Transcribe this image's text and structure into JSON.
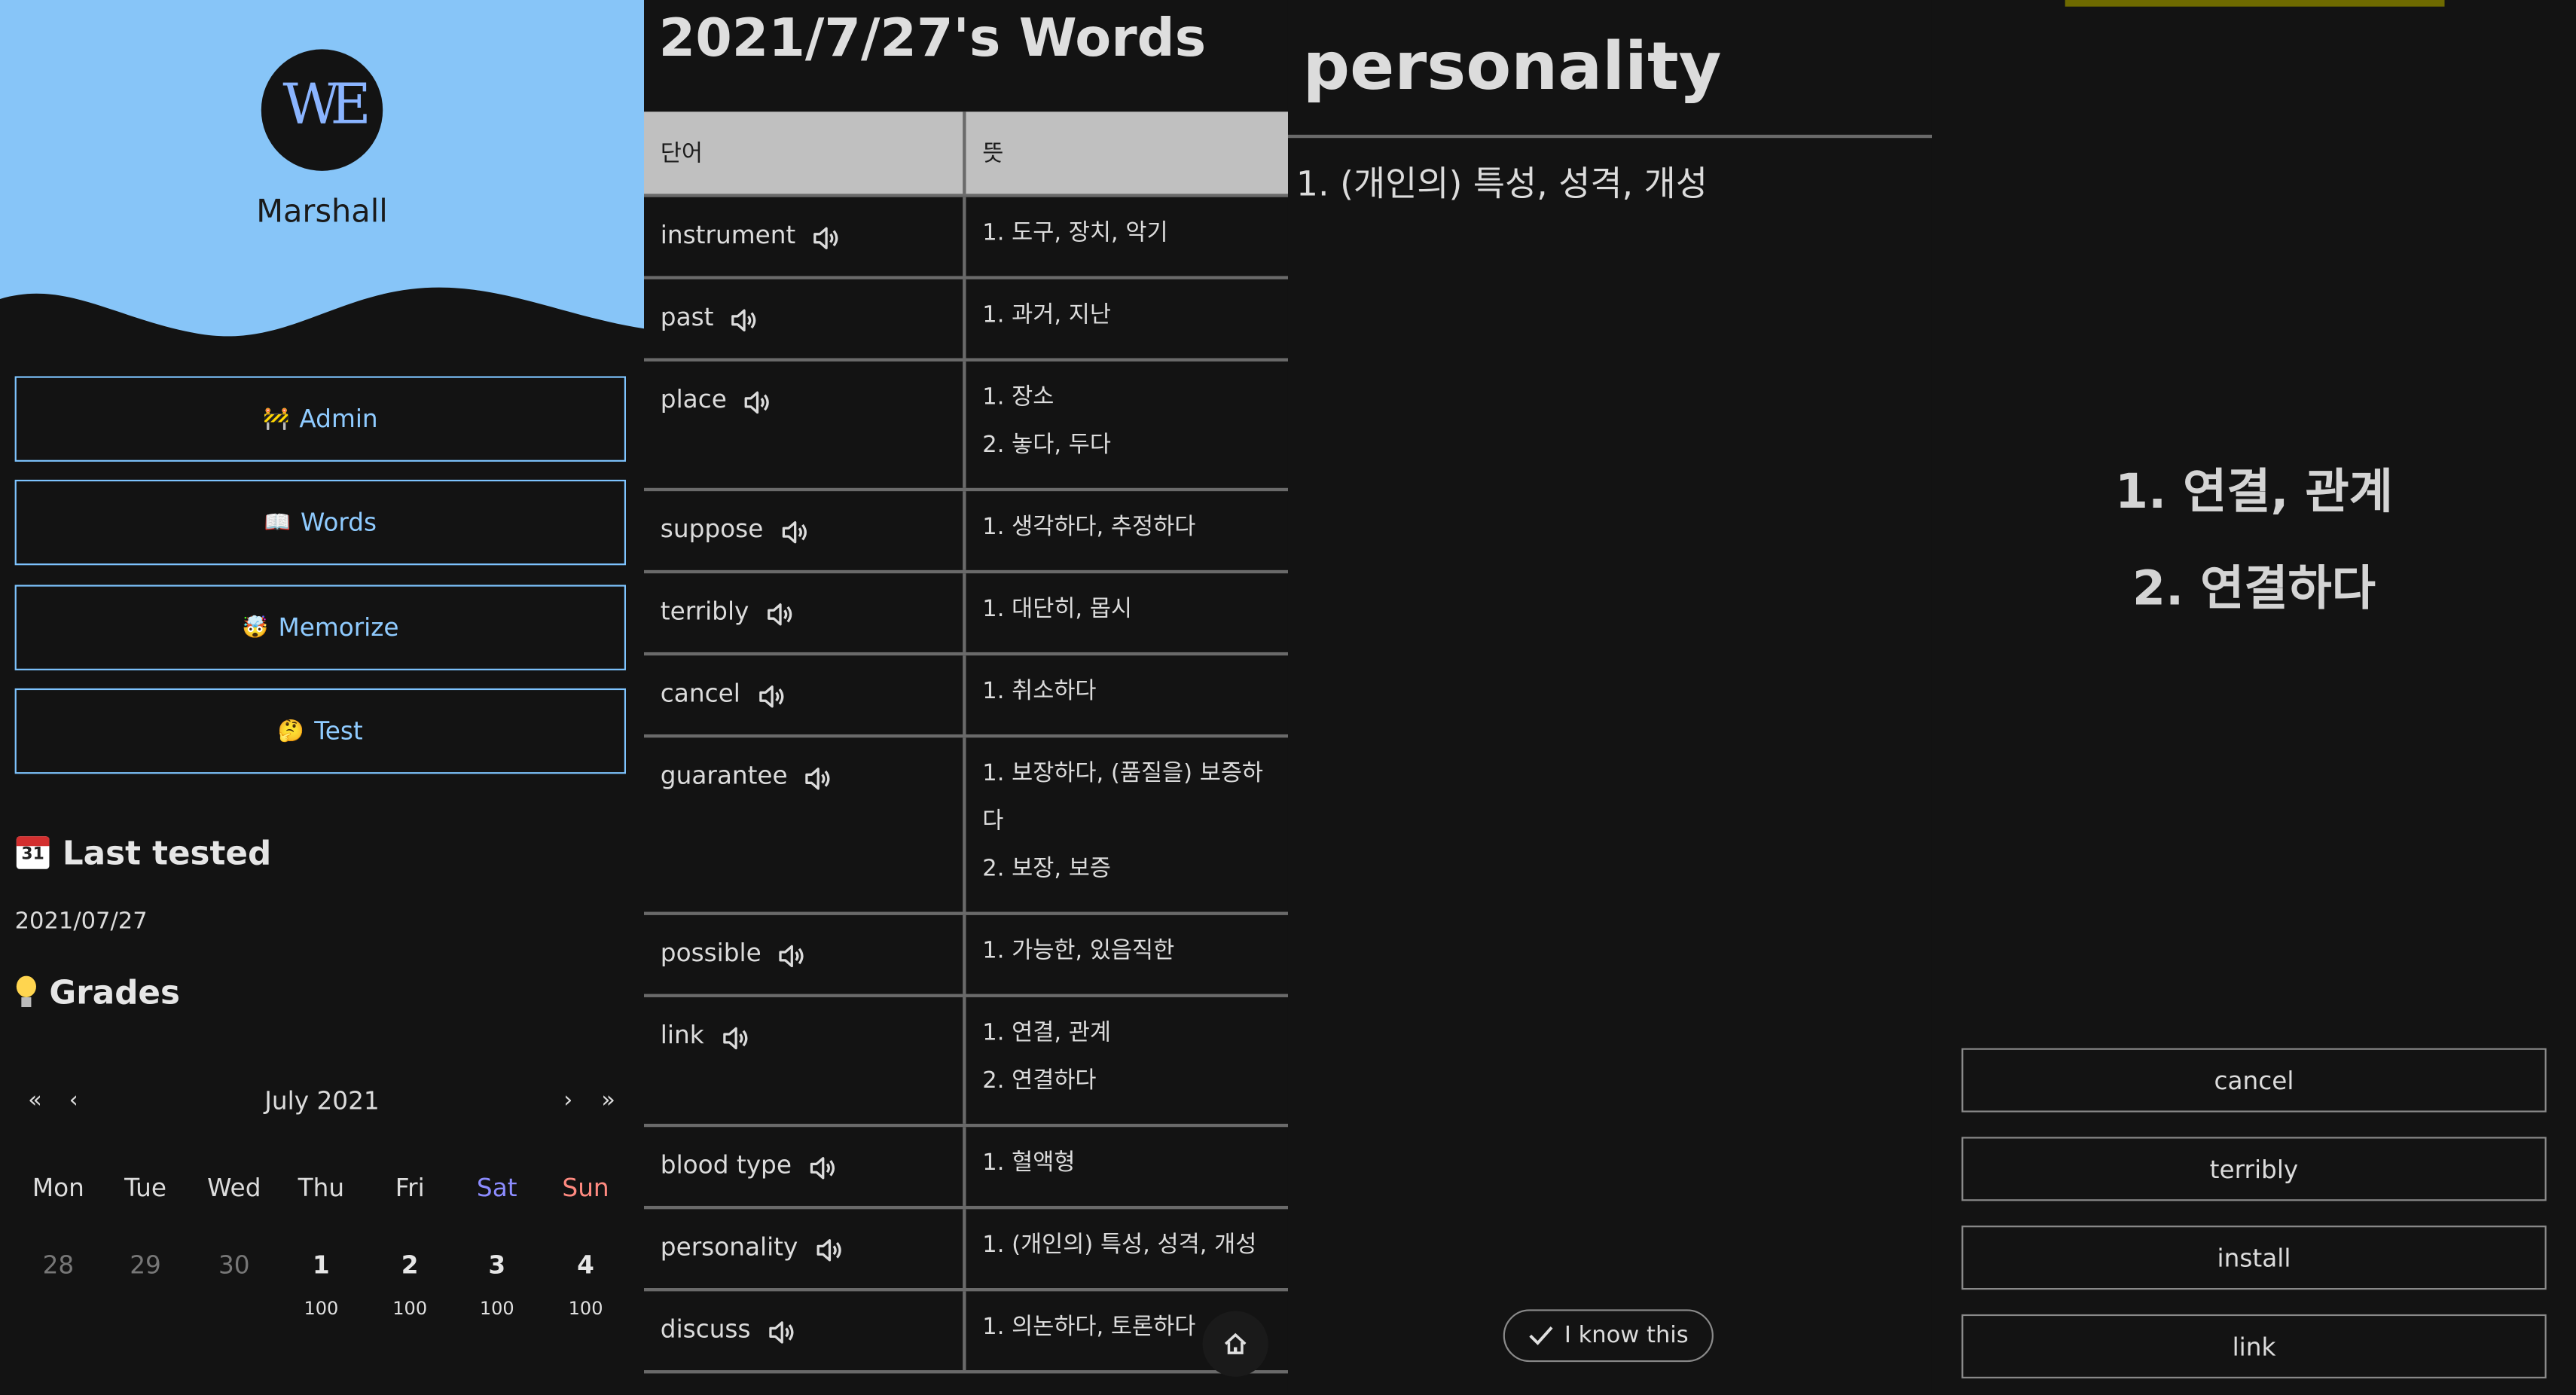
{
  "sidebar": {
    "logo_text": "WE",
    "username": "Marshall",
    "nav": [
      {
        "emoji": "🚧",
        "label": "Admin"
      },
      {
        "emoji": "📖",
        "label": "Words"
      },
      {
        "emoji": "🤯",
        "label": "Memorize"
      },
      {
        "emoji": "🤔",
        "label": "Test"
      }
    ],
    "last_tested_title": "Last tested",
    "last_tested_date": "2021/07/27",
    "grades_title": "Grades",
    "calendar": {
      "nav_first": "«",
      "nav_prev": "‹",
      "nav_next": "›",
      "nav_last": "»",
      "month": "July 2021",
      "weekdays": [
        "Mon",
        "Tue",
        "Wed",
        "Thu",
        "Fri",
        "Sat",
        "Sun"
      ],
      "days": [
        "28",
        "29",
        "30",
        "1",
        "2",
        "3",
        "4"
      ],
      "grades": [
        "",
        "",
        "",
        "100",
        "100",
        "100",
        "100"
      ]
    },
    "colors": {
      "header_bg": "#87c5f8",
      "accent": "#8fcbff",
      "sat": "#8c8cff",
      "sun": "#ff8a80"
    }
  },
  "words_list": {
    "title": "2021/7/27's Words",
    "col_word": "단어",
    "col_meaning": "뜻",
    "rows": [
      {
        "word": "instrument",
        "meanings": [
          "1. 도구, 장치, 악기"
        ]
      },
      {
        "word": "past",
        "meanings": [
          "1. 과거, 지난"
        ]
      },
      {
        "word": "place",
        "meanings": [
          "1. 장소",
          "2. 놓다, 두다"
        ]
      },
      {
        "word": "suppose",
        "meanings": [
          "1. 생각하다, 추정하다"
        ]
      },
      {
        "word": "terribly",
        "meanings": [
          "1. 대단히, 몹시"
        ]
      },
      {
        "word": "cancel",
        "meanings": [
          "1. 취소하다"
        ]
      },
      {
        "word": "guarantee",
        "meanings": [
          "1. 보장하다, (품질을) 보증하",
          "다",
          "2. 보장, 보증"
        ]
      },
      {
        "word": "possible",
        "meanings": [
          "1. 가능한, 있음직한"
        ]
      },
      {
        "word": "link",
        "meanings": [
          "1. 연결, 관계",
          "2. 연결하다"
        ]
      },
      {
        "word": "blood type",
        "meanings": [
          "1. 혈액형"
        ]
      },
      {
        "word": "personality",
        "meanings": [
          "1. (개인의) 특성, 성격, 개성"
        ]
      },
      {
        "word": "discuss",
        "meanings": [
          "1. 의논하다, 토론하다"
        ]
      }
    ]
  },
  "memorize": {
    "word": "personality",
    "meaning": "1. (개인의) 특성, 성격, 개성",
    "know_label": "I know this"
  },
  "test": {
    "progress": 0.59,
    "meanings": [
      "1. 연결, 관계",
      "2. 연결하다"
    ],
    "choices": [
      "cancel",
      "terribly",
      "install",
      "link"
    ]
  }
}
